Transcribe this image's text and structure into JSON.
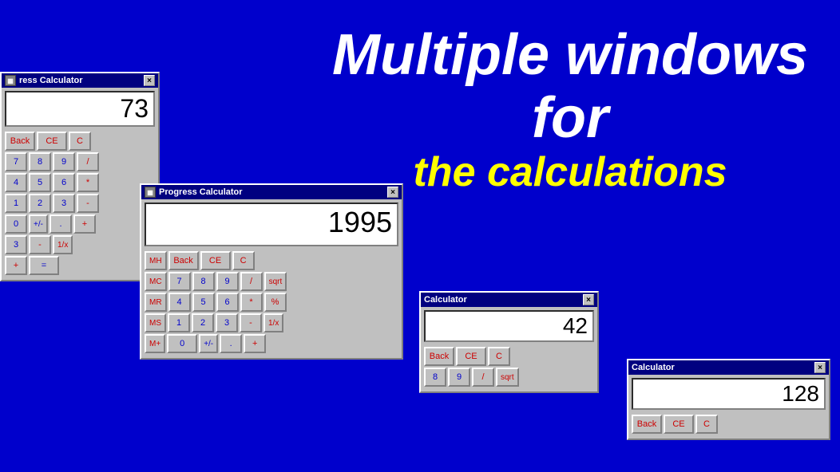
{
  "background": "#0000cc",
  "promo": {
    "line1": "Multiple windows",
    "line2": "for",
    "line3": "the calculations"
  },
  "calc1": {
    "title": "ress Calculator",
    "display": "73",
    "buttons_row1": [
      "Back",
      "CE",
      "C"
    ],
    "buttons_row2": [
      "7",
      "8",
      "9",
      "/"
    ],
    "buttons_row3": [
      "4",
      "5",
      "6",
      "*"
    ],
    "buttons_row4": [
      "1",
      "2",
      "3",
      "-"
    ],
    "buttons_row5": [
      "0",
      "+/-",
      ".",
      "+"
    ],
    "buttons_row6": [
      "3",
      "-",
      "1/x"
    ],
    "buttons_row7": [
      "+",
      "="
    ]
  },
  "calc2": {
    "title": "Progress Calculator",
    "display": "1995",
    "row1": [
      "MH",
      "Back",
      "CE",
      "C"
    ],
    "row2": [
      "MC",
      "7",
      "8",
      "9",
      "/",
      "sqrt"
    ],
    "row3": [
      "MR",
      "4",
      "5",
      "6",
      "*",
      "%"
    ],
    "row4": [
      "MS",
      "1",
      "2",
      "3",
      "-",
      "1/x"
    ],
    "row5": [
      "M+",
      "0",
      "+/-",
      ".",
      "+"
    ]
  },
  "calc3": {
    "title": "Calculator",
    "display": "42",
    "row1": [
      "Back",
      "CE",
      "C"
    ],
    "row2": [
      "8",
      "9",
      "/",
      "sqrt"
    ]
  },
  "calc4": {
    "title": "Calculator",
    "display": "128",
    "row1": [
      "Back",
      "CE",
      "C"
    ]
  },
  "icons": {
    "close": "×",
    "calc_icon": "▦"
  }
}
